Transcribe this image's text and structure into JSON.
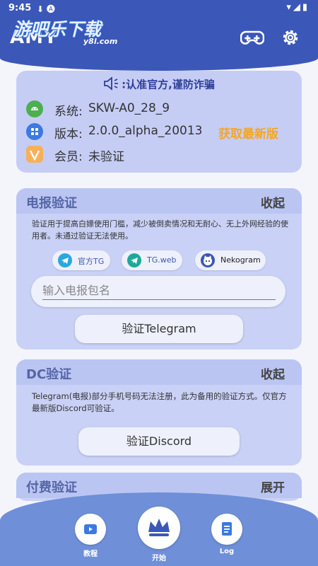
{
  "status": {
    "time": "9:45",
    "icons": "⬇ 🅐",
    "right_icons": "▾◢▮"
  },
  "app": {
    "title": "AMY",
    "watermark": "游吧乐下载",
    "watermark_sub": "y8l.com"
  },
  "notice": {
    "text": ":认准官方,谨防诈骗"
  },
  "info": {
    "system_label": "系统:",
    "system_value": "SKW-A0_28_9",
    "version_label": "版本:",
    "version_value": "2.0.0_alpha_20013",
    "update_link": "获取最新版",
    "member_label": "会员:",
    "member_value": "未验证"
  },
  "telegram": {
    "title": "电报验证",
    "toggle": "收起",
    "desc": "验证用于提高白嫖使用门槛，减少被倒卖情况和无耐心、无上外网经验的使用者。未通过验证无法使用。",
    "chips": [
      "官方TG",
      "TG.web",
      "Nekogram"
    ],
    "input_placeholder": "输入电报包名",
    "verify_button": "验证Telegram"
  },
  "discord": {
    "title": "DC验证",
    "toggle": "收起",
    "desc": "Telegram(电报)部分手机号码无法注册，此为备用的验证方式。仅官方最新版Discord可验证。",
    "verify_button": "验证Discord"
  },
  "paid": {
    "title": "付费验证",
    "toggle": "展开"
  },
  "nav": {
    "tutorial": "教程",
    "start": "开始",
    "log": "Log"
  },
  "colors": {
    "header": "#3b57b8",
    "accent_update": "#f5a623",
    "nav_bg": "#6f8fd8",
    "card": "#c9d1f6"
  }
}
